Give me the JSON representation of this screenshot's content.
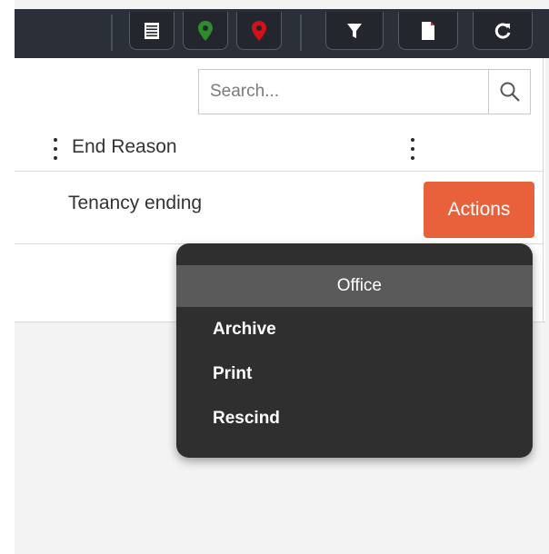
{
  "toolbar": {
    "buttons": [
      {
        "icon": "list-icon"
      },
      {
        "icon": "green-map-pin-icon",
        "color": "#2e8b2e"
      },
      {
        "icon": "red-map-pin-icon",
        "color": "#d0121b"
      },
      {
        "icon": "filter-icon"
      },
      {
        "icon": "document-icon"
      },
      {
        "icon": "refresh-icon"
      }
    ]
  },
  "search": {
    "placeholder": "Search..."
  },
  "table": {
    "columns": [
      "End Reason"
    ],
    "rows": [
      {
        "end_reason": "Tenancy ending",
        "action_label": "Actions"
      }
    ]
  },
  "actions_menu": {
    "header": "Office",
    "items": [
      "Archive",
      "Print",
      "Rescind"
    ]
  },
  "colors": {
    "toolbar_bg": "#2b3038",
    "accent": "#e8613a",
    "menu_bg": "#2f2f2f",
    "menu_header_bg": "#5a5a5a"
  }
}
